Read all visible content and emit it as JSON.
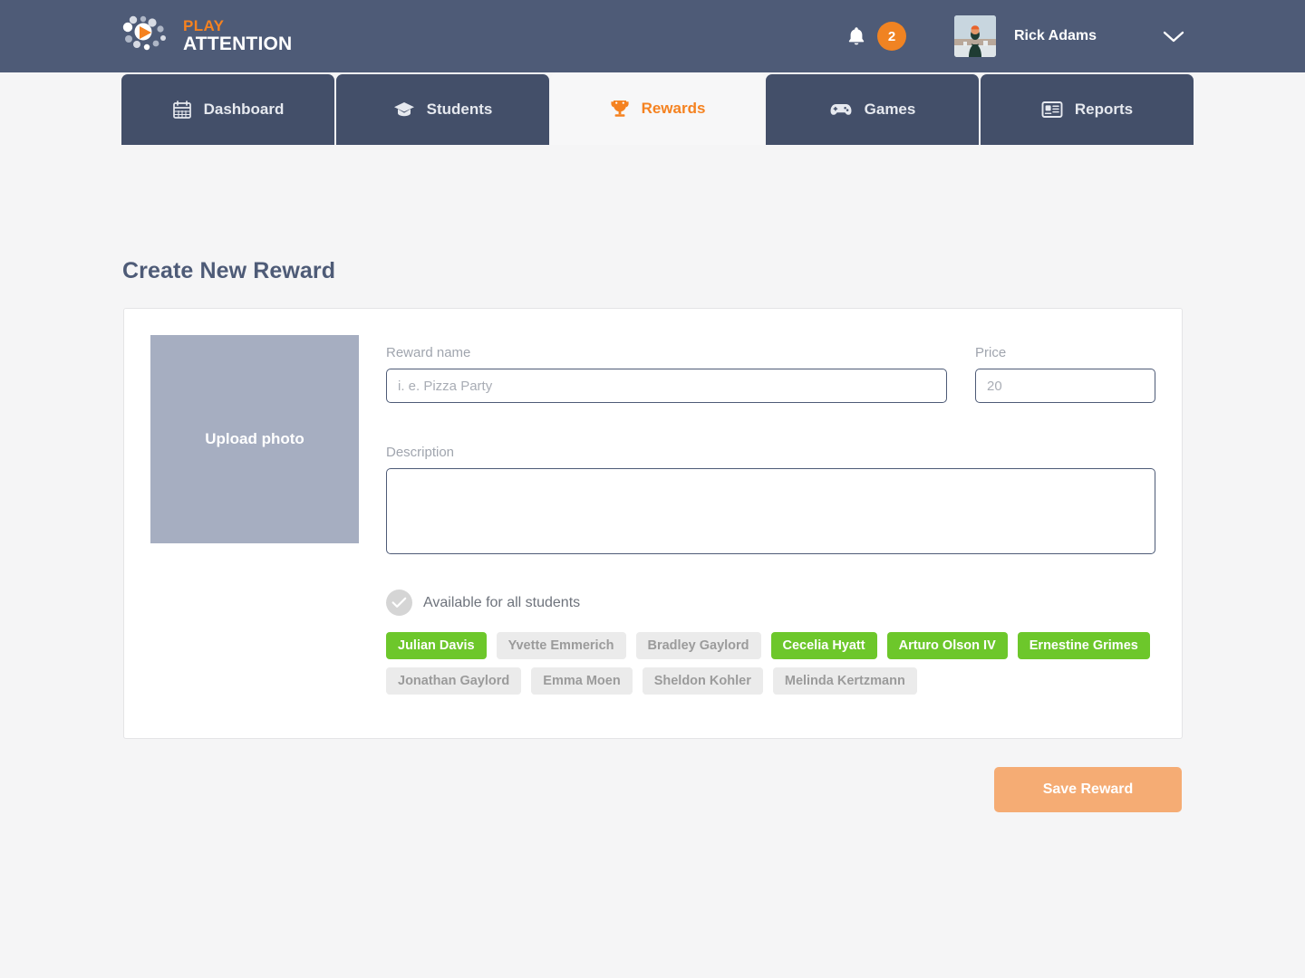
{
  "brand": {
    "logo_line1": "PLAY",
    "logo_line2": "ATTENTION",
    "accent_orange": "#f58220",
    "header_bg": "#4e5b77",
    "tab_bg": "#434f69",
    "page_bg": "#f5f5f6",
    "chip_selected_green": "#6dc72b"
  },
  "header": {
    "notifications_icon": "bell-icon",
    "notifications_count": "2",
    "user_name": "Rick Adams",
    "dropdown_icon": "chevron-down-icon"
  },
  "nav": {
    "tabs": [
      {
        "label": "Dashboard",
        "icon": "calendar-icon",
        "active": false
      },
      {
        "label": "Students",
        "icon": "graduation-cap-icon",
        "active": false
      },
      {
        "label": "Rewards",
        "icon": "trophy-icon",
        "active": true
      },
      {
        "label": "Games",
        "icon": "gamepad-icon",
        "active": false
      },
      {
        "label": "Reports",
        "icon": "report-card-icon",
        "active": false
      }
    ]
  },
  "page": {
    "title": "Create New Reward"
  },
  "form": {
    "upload_label": "Upload photo",
    "reward_name": {
      "label": "Reward name",
      "value": "",
      "placeholder": "i. e. Pizza Party"
    },
    "price": {
      "label": "Price",
      "value": "",
      "placeholder": "20"
    },
    "description": {
      "label": "Description",
      "value": "",
      "placeholder": ""
    },
    "available_all": {
      "label": "Available for all students",
      "checked": false,
      "icon": "check-circle-icon"
    },
    "students": [
      {
        "name": "Julian Davis",
        "selected": true
      },
      {
        "name": "Yvette Emmerich",
        "selected": false
      },
      {
        "name": "Bradley Gaylord",
        "selected": false
      },
      {
        "name": "Cecelia Hyatt",
        "selected": true
      },
      {
        "name": "Arturo Olson IV",
        "selected": true
      },
      {
        "name": "Ernestine Grimes",
        "selected": true
      },
      {
        "name": "Jonathan Gaylord",
        "selected": false
      },
      {
        "name": "Emma Moen",
        "selected": false
      },
      {
        "name": "Sheldon Kohler",
        "selected": false
      },
      {
        "name": "Melinda Kertzmann",
        "selected": false
      }
    ]
  },
  "actions": {
    "save_label": "Save Reward"
  }
}
